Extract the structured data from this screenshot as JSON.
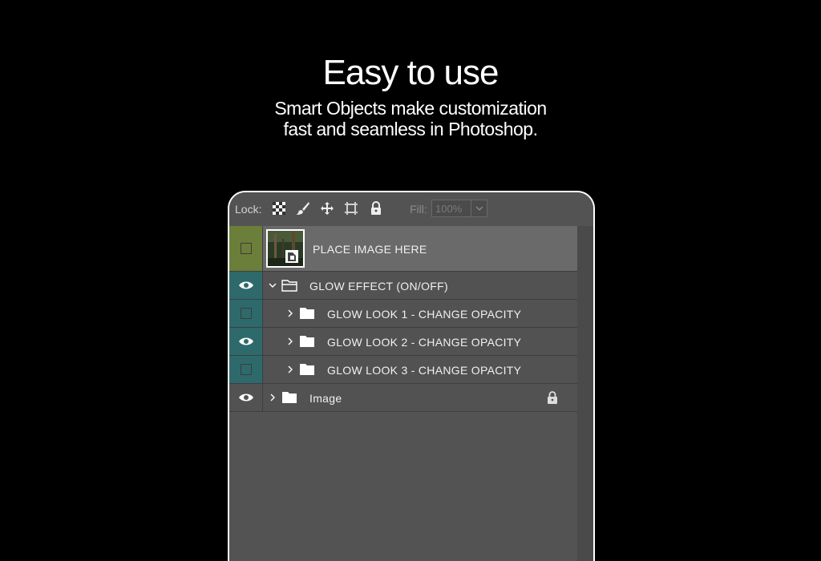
{
  "hero": {
    "title": "Easy to use",
    "subtitle_line1": "Smart Objects make customization",
    "subtitle_line2": "fast and seamless in Photoshop."
  },
  "toolbar": {
    "lock_label": "Lock:",
    "fill_label": "Fill:",
    "fill_value": "100%",
    "icons": [
      "lock-transparent-pixels-icon",
      "lock-image-pixels-icon",
      "lock-position-icon",
      "lock-artboard-icon",
      "lock-all-icon"
    ]
  },
  "layers": [
    {
      "name": "PLACE IMAGE HERE",
      "type": "smart-object",
      "visible": false,
      "color_tag": "#6b7e3a"
    },
    {
      "name": "GLOW EFFECT (ON/OFF)",
      "type": "group-open",
      "visible": true,
      "color_tag": "#2e6a6b"
    },
    {
      "name": "GLOW LOOK 1 - CHANGE OPACITY",
      "type": "group-closed",
      "visible": false,
      "color_tag": "#2e6a6b"
    },
    {
      "name": "GLOW LOOK 2 - CHANGE OPACITY",
      "type": "group-closed",
      "visible": true,
      "color_tag": "#2e6a6b"
    },
    {
      "name": "GLOW LOOK 3 - CHANGE OPACITY",
      "type": "group-closed",
      "visible": false,
      "color_tag": "#2e6a6b"
    },
    {
      "name": "Image",
      "type": "group-closed",
      "visible": true,
      "locked": true,
      "color_tag": ""
    }
  ]
}
